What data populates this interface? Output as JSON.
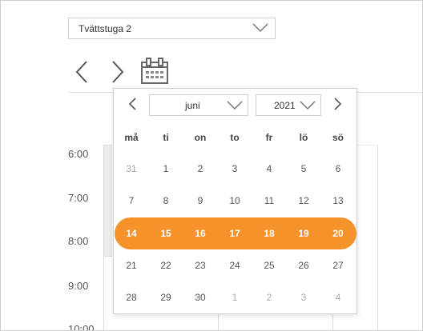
{
  "room_select": {
    "value": "Tvättstuga 2"
  },
  "icons": {
    "prev": "chevron-left-icon",
    "next": "chevron-right-icon",
    "calendar": "calendar-icon",
    "dropdown": "chevron-down-icon"
  },
  "times": [
    "6:00",
    "7:00",
    "8:00",
    "9:00",
    "10:00"
  ],
  "datepicker": {
    "month": "juni",
    "year": "2021",
    "weekdays": [
      "må",
      "ti",
      "on",
      "to",
      "fr",
      "lö",
      "sö"
    ],
    "weeks": [
      [
        "31",
        "1",
        "2",
        "3",
        "4",
        "5",
        "6"
      ],
      [
        "7",
        "8",
        "9",
        "10",
        "11",
        "12",
        "13"
      ],
      [
        "14",
        "15",
        "16",
        "17",
        "18",
        "19",
        "20"
      ],
      [
        "21",
        "22",
        "23",
        "24",
        "25",
        "26",
        "27"
      ],
      [
        "28",
        "29",
        "30",
        "1",
        "2",
        "3",
        "4"
      ]
    ],
    "selected_week_index": 2
  },
  "colors": {
    "accent": "#f5922a",
    "border": "#cfcfcf",
    "muted_text": "#aaaaaa"
  }
}
